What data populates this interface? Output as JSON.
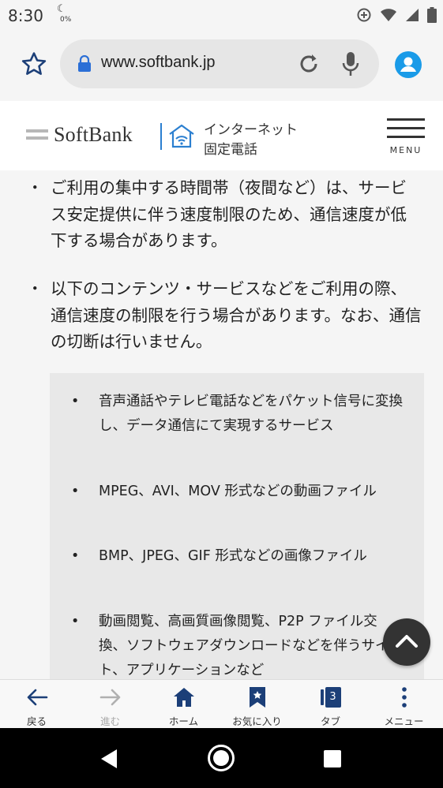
{
  "status_bar": {
    "time": "8:30",
    "battery_saver_percent": "0%"
  },
  "browser": {
    "url": "www.softbank.jp",
    "icons": [
      "bookmark-star-icon",
      "lock-icon",
      "reload-icon",
      "mic-icon",
      "account-icon"
    ]
  },
  "site_header": {
    "logo_text": "SoftBank",
    "service_line1": "インターネット",
    "service_line2": "固定電話",
    "menu_label": "MENU"
  },
  "content": {
    "bullet_mark": "・",
    "items": [
      {
        "text": "ご利用の集中する時間帯（夜間など）は、サービス安定提供に伴う速度制限のため、通信速度が低下する場合があります。"
      },
      {
        "text": "以下のコンテンツ・サービスなどをご利用の際、通信速度の制限を行う場合があります。なお、通信の切断は行いません。"
      }
    ],
    "sub_bullet_mark": "•",
    "sub_items": [
      {
        "text": "音声通話やテレビ電話などをパケット信号に変換し、データ通信にて実現するサービス"
      },
      {
        "text": "MPEG、AVI、MOV 形式などの動画ファイル"
      },
      {
        "text": "BMP、JPEG、GIF 形式などの画像ファイル"
      },
      {
        "text": "動画閲覧、高画質画像閲覧、P2P ファイル交換、ソフトウェアダウンロードなどを伴うサイト、アプリケーションなど"
      }
    ]
  },
  "bottom_nav": {
    "items": [
      {
        "label": "戻る",
        "icon": "back-arrow-icon",
        "enabled": true
      },
      {
        "label": "進む",
        "icon": "forward-arrow-icon",
        "enabled": false
      },
      {
        "label": "ホーム",
        "icon": "home-icon",
        "enabled": true
      },
      {
        "label": "お気に入り",
        "icon": "bookmark-icon",
        "enabled": true
      },
      {
        "label": "タブ",
        "icon": "tabs-icon",
        "enabled": true,
        "count": "3"
      },
      {
        "label": "メニュー",
        "icon": "more-vertical-icon",
        "enabled": true
      }
    ]
  },
  "colors": {
    "accent": "#1a9be8",
    "progress": "#3a7bd5",
    "scroll_button": "#333333"
  }
}
